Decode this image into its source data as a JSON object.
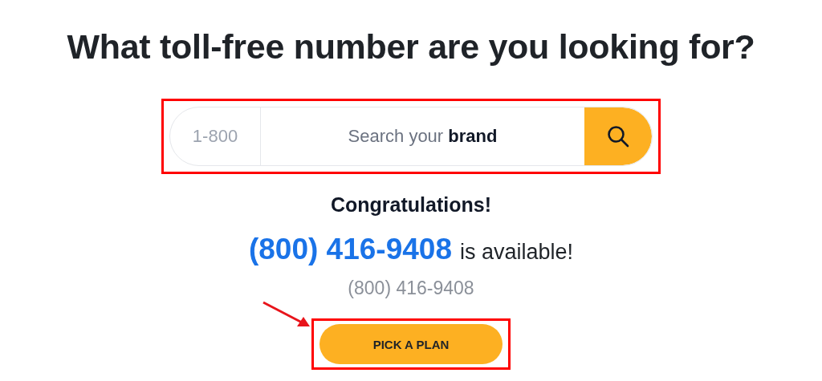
{
  "heading": "What toll-free number are you looking for?",
  "search": {
    "prefix": "1-800",
    "placeholder": "Search your **brand**",
    "highlighted": true
  },
  "result": {
    "title": "Congratulations!",
    "number": "(800) 416-9408",
    "status": "is available!",
    "number_secondary": "(800) 416-9408"
  },
  "action": {
    "label": "PICK A PLAN",
    "highlighted": true,
    "arrow": true
  }
}
